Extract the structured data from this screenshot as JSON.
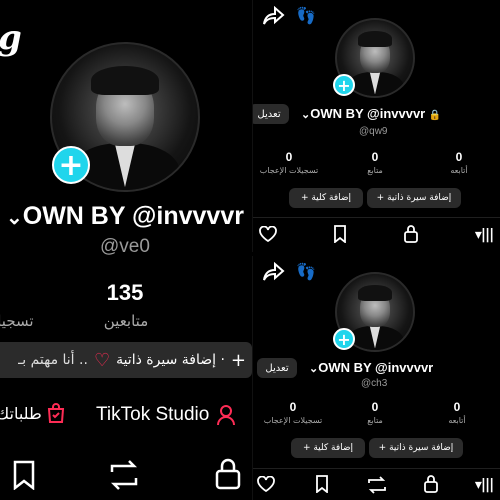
{
  "left_profile": {
    "display_name": "OWN BY @invvvvr",
    "handle": "@ve0",
    "following_count": "135",
    "following_label": "متابعين",
    "cut_stat_label": "تسجيل",
    "bio_action": "إضافة سيرة ذاتية ·",
    "interests_text": "أنا مهتم بـ ..",
    "studio_label": "TikTok Studio",
    "orders_label": "طلباتك",
    "partial_top_glyph": "g"
  },
  "top_right_profile": {
    "display_name": "OWN BY @invvvvr",
    "handle": "@qw9",
    "edit_label": "تعديل",
    "stats": [
      {
        "value": "0",
        "label": "تسجيلات الإعجاب"
      },
      {
        "value": "0",
        "label": "متابع"
      },
      {
        "value": "0",
        "label": "أتابعه"
      }
    ],
    "add_bio": "+ إضافة سيرة ذاتية",
    "add_college": "+ إضافة كلية"
  },
  "bottom_right_profile": {
    "display_name": "OWN BY @invvvvr",
    "handle": "@ch3",
    "edit_label": "تعديل",
    "stats": [
      {
        "value": "0",
        "label": "تسجيلات الإعجاب"
      },
      {
        "value": "0",
        "label": "متابع"
      },
      {
        "value": "0",
        "label": "أتابعه"
      }
    ],
    "add_bio": "+ إضافة سيرة ذاتية",
    "add_college": "+ إضافة كلية"
  },
  "colors": {
    "accent_plus": "#20d5ec",
    "heart_red": "#fe2c55",
    "background": "#000000",
    "pill_bg": "#2b2b2b"
  },
  "icons": [
    "share-icon",
    "footprints-icon",
    "plus-icon",
    "lock-icon",
    "heart-icon",
    "bookmark-icon",
    "repost-icon",
    "person-icon",
    "bag-icon",
    "menu-icon",
    "chevron-down-icon"
  ]
}
